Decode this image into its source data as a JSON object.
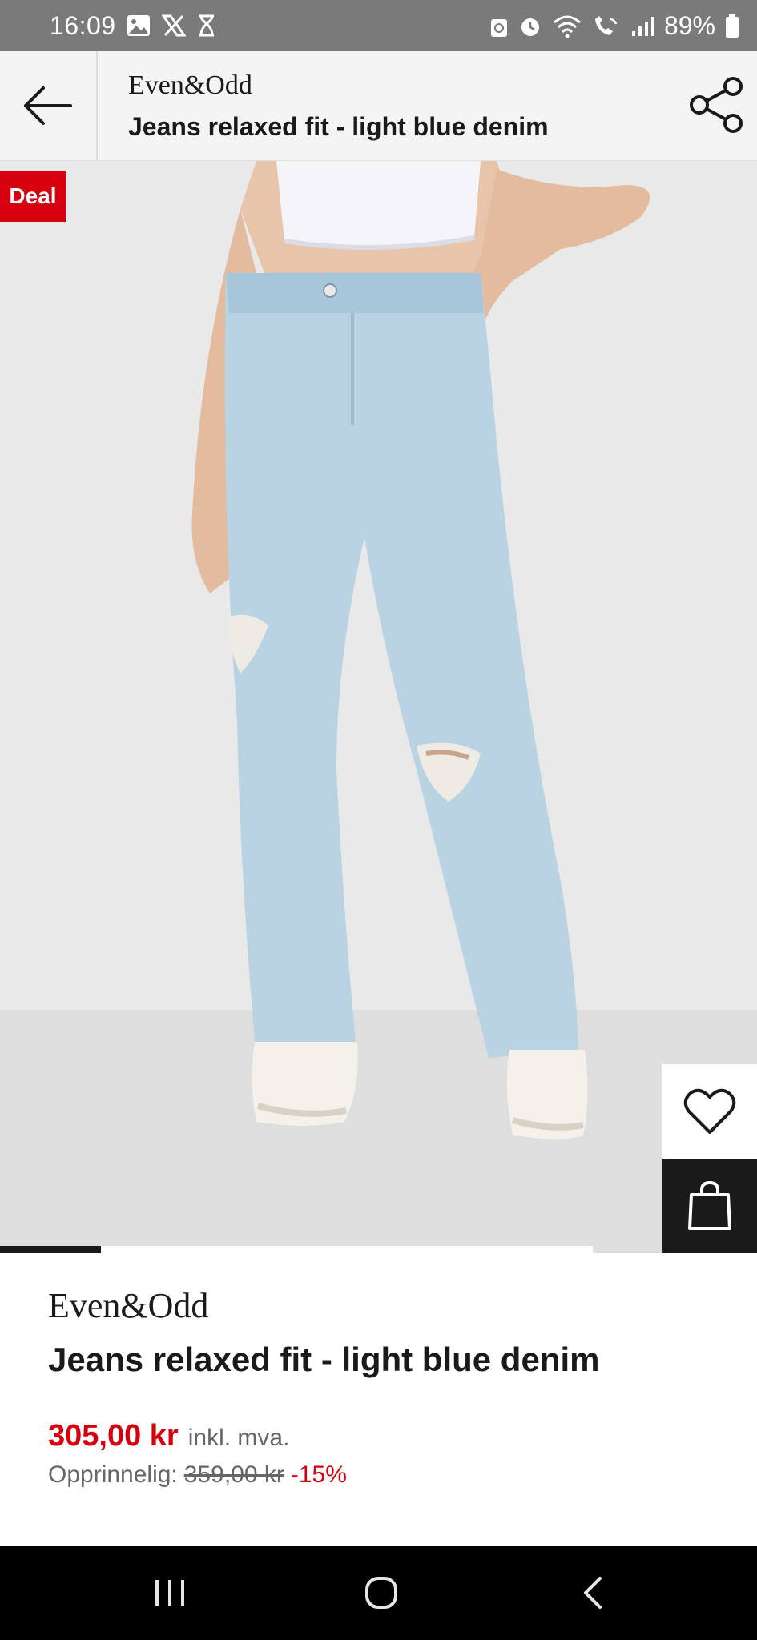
{
  "status_bar": {
    "time": "16:09",
    "battery": "89%",
    "icons": [
      "image-icon",
      "x-logo-icon",
      "hourglass-icon",
      "recycle-icon",
      "alarm-icon",
      "wifi-icon",
      "wifi-call-icon",
      "signal-icon",
      "battery-icon"
    ]
  },
  "header": {
    "brand": "Even&Odd",
    "title": "Jeans relaxed fit - light blue denim",
    "icons": [
      "back-arrow-icon",
      "share-icon"
    ]
  },
  "hero": {
    "badge": "Deal",
    "gallery_progress_fraction": 0.17,
    "icons": [
      "heart-icon",
      "shopping-bag-icon"
    ],
    "colors": {
      "badge": "#d7000f",
      "denim": "#b9d3e3",
      "background": "#e9e9ea"
    }
  },
  "product": {
    "brand": "Even&Odd",
    "name": "Jeans relaxed fit - light blue denim",
    "price": "305,00 kr",
    "vat_label": "inkl. mva.",
    "original_label": "Opprinnelig:",
    "original_price": "359,00 kr",
    "discount": "-15%"
  },
  "nav": {
    "icons": [
      "recent-apps-icon",
      "home-icon",
      "back-icon"
    ]
  }
}
